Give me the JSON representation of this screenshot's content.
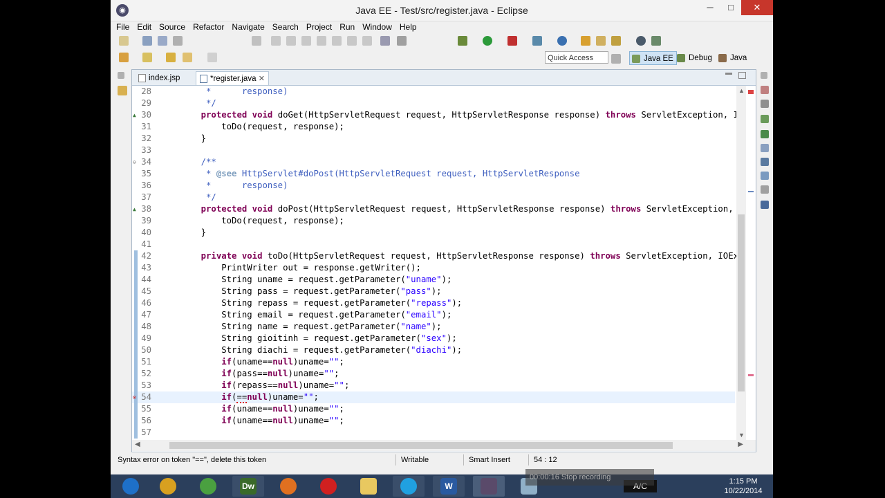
{
  "window": {
    "title": "Java EE - Test/src/register.java - Eclipse",
    "minimize": "─",
    "maximize": "□",
    "close": "✕",
    "app_icon": "eclipse-icon"
  },
  "menu": [
    "File",
    "Edit",
    "Source",
    "Refactor",
    "Navigate",
    "Search",
    "Project",
    "Run",
    "Window",
    "Help"
  ],
  "quick_access": "Quick Access",
  "perspectives": [
    "Java EE",
    "Debug",
    "Java"
  ],
  "tabs": [
    {
      "label": "index.jsp"
    },
    {
      "label": "*register.java"
    }
  ],
  "tab_close": "✕",
  "code_lines": [
    {
      "n": "28",
      "text": "     *      response)",
      "style": "cm",
      "mark": "",
      "bar": false
    },
    {
      "n": "29",
      "text": "     */",
      "style": "cm",
      "mark": "",
      "bar": false
    },
    {
      "n": "30",
      "text": "    protected void doGet(HttpServletRequest request, HttpServletResponse response) throws ServletException, IOE",
      "style": "code",
      "mark": "▲",
      "bar": false
    },
    {
      "n": "31",
      "text": "        toDo(request, response);",
      "style": "code",
      "mark": "",
      "bar": false
    },
    {
      "n": "32",
      "text": "    }",
      "style": "code",
      "mark": "",
      "bar": false
    },
    {
      "n": "33",
      "text": "",
      "style": "code",
      "mark": "",
      "bar": false
    },
    {
      "n": "34",
      "text": "    /**",
      "style": "cm",
      "mark": "⊖",
      "bar": false
    },
    {
      "n": "35",
      "text": "     * @see HttpServlet#doPost(HttpServletRequest request, HttpServletResponse",
      "style": "cm",
      "mark": "",
      "bar": false
    },
    {
      "n": "36",
      "text": "     *      response)",
      "style": "cm",
      "mark": "",
      "bar": false
    },
    {
      "n": "37",
      "text": "     */",
      "style": "cm",
      "mark": "",
      "bar": false
    },
    {
      "n": "38",
      "text": "    protected void doPost(HttpServletRequest request, HttpServletResponse response) throws ServletException, IO",
      "style": "code",
      "mark": "▲",
      "bar": false
    },
    {
      "n": "39",
      "text": "        toDo(request, response);",
      "style": "code",
      "mark": "",
      "bar": false
    },
    {
      "n": "40",
      "text": "    }",
      "style": "code",
      "mark": "",
      "bar": false
    },
    {
      "n": "41",
      "text": "",
      "style": "code",
      "mark": "",
      "bar": false
    },
    {
      "n": "42",
      "text": "    private void toDo(HttpServletRequest request, HttpServletResponse response) throws ServletException, IOExce",
      "style": "code",
      "mark": "",
      "bar": true
    },
    {
      "n": "43",
      "text": "        PrintWriter out = response.getWriter();",
      "style": "code",
      "mark": "",
      "bar": true
    },
    {
      "n": "44",
      "text": "        String uname = request.getParameter(\"uname\");",
      "style": "code",
      "mark": "",
      "bar": true
    },
    {
      "n": "45",
      "text": "        String pass = request.getParameter(\"pass\");",
      "style": "code",
      "mark": "",
      "bar": true
    },
    {
      "n": "46",
      "text": "        String repass = request.getParameter(\"repass\");",
      "style": "code",
      "mark": "",
      "bar": true
    },
    {
      "n": "47",
      "text": "        String email = request.getParameter(\"email\");",
      "style": "code",
      "mark": "",
      "bar": true
    },
    {
      "n": "48",
      "text": "        String name = request.getParameter(\"name\");",
      "style": "code",
      "mark": "",
      "bar": true
    },
    {
      "n": "49",
      "text": "        String gioitinh = request.getParameter(\"sex\");",
      "style": "code",
      "mark": "",
      "bar": true
    },
    {
      "n": "50",
      "text": "        String diachi = request.getParameter(\"diachi\");",
      "style": "code",
      "mark": "",
      "bar": true
    },
    {
      "n": "51",
      "text": "        if(uname==null)uname=\"\";",
      "style": "code",
      "mark": "",
      "bar": true
    },
    {
      "n": "52",
      "text": "        if(pass==null)uname=\"\";",
      "style": "code",
      "mark": "",
      "bar": true
    },
    {
      "n": "53",
      "text": "        if(repass==null)uname=\"\";",
      "style": "code",
      "mark": "",
      "bar": true
    },
    {
      "n": "54",
      "text": "        if(==null)uname=\"\";",
      "style": "code",
      "mark": "⊗",
      "bar": true
    },
    {
      "n": "55",
      "text": "        if(uname==null)uname=\"\";",
      "style": "code",
      "mark": "",
      "bar": true
    },
    {
      "n": "56",
      "text": "        if(uname==null)uname=\"\";",
      "style": "code",
      "mark": "",
      "bar": true
    },
    {
      "n": "57",
      "text": "",
      "style": "code",
      "mark": "",
      "bar": true
    }
  ],
  "status": {
    "message": "Syntax error on token \"==\", delete this token",
    "writable": "Writable",
    "insert": "Smart Insert",
    "position": "54 : 12"
  },
  "taskbar": {
    "lang": "A/C",
    "time": "1:15 PM",
    "date": "10/22/2014",
    "overlay": "00:00:16   Stop recording",
    "apps": [
      "start-button",
      "chrome-icon",
      "clover-icon",
      "dreamweaver-icon",
      "firefox-icon",
      "opera-icon",
      "folder-icon",
      "skype-icon",
      "word-icon",
      "eclipse-icon",
      "notepad-icon"
    ],
    "dw": "Dw",
    "word": "W"
  },
  "colors": {
    "keyword": "#7f0055",
    "string": "#2a00ff",
    "comment": "#3f5fbf",
    "error": "#dd0000",
    "accent": "#2b3f5c"
  }
}
